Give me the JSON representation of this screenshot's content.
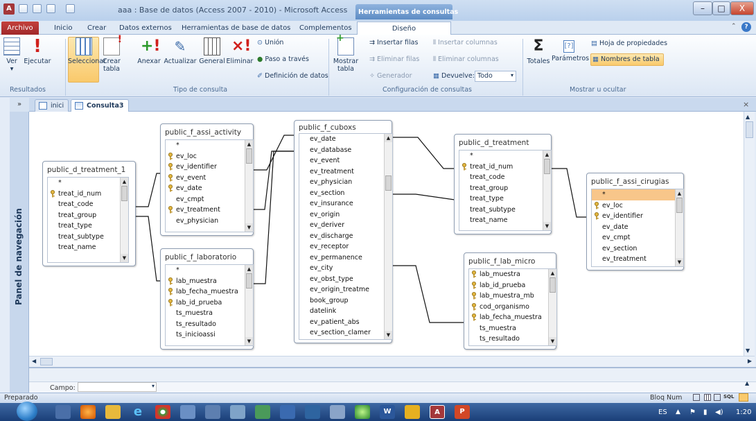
{
  "window": {
    "title": "aaa : Base de datos (Access 2007 - 2010) - Microsoft Access",
    "context_tab_title": "Herramientas de consultas",
    "minimize": "–",
    "maximize": "□",
    "close": "X"
  },
  "menu": {
    "file": "Archivo",
    "tabs": [
      "Inicio",
      "Crear",
      "Datos externos",
      "Herramientas de base de datos",
      "Complementos"
    ],
    "design_tab": "Diseño"
  },
  "ribbon": {
    "results": {
      "ver": "Ver",
      "ejecutar": "Ejecutar",
      "group": "Resultados"
    },
    "query_type": {
      "seleccionar": "Seleccionar",
      "crear_tabla": "Crear tabla",
      "anexar": "Anexar",
      "actualizar": "Actualizar",
      "general": "General",
      "eliminar": "Eliminar",
      "union": "Unión",
      "paso_traves": "Paso a través",
      "definicion": "Definición de datos",
      "group": "Tipo de consulta"
    },
    "setup": {
      "mostrar_tabla": "Mostrar tabla",
      "insertar_filas": "Insertar filas",
      "eliminar_filas": "Eliminar filas",
      "generador": "Generador",
      "insertar_columnas": "Insertar columnas",
      "eliminar_columnas": "Eliminar columnas",
      "devuelve": "Devuelve:",
      "devuelve_value": "Todo",
      "group": "Configuración de consultas"
    },
    "show": {
      "totales": "Totales",
      "parametros": "Parámetros",
      "hoja_prop": "Hoja de propiedades",
      "nombres_tabla": "Nombres de tabla",
      "group": "Mostrar u ocultar"
    }
  },
  "nav": {
    "toggle": "»",
    "label": "Panel de navegación"
  },
  "doctabs": {
    "tab1": "inici",
    "tab2": "Consulta3",
    "close": "×"
  },
  "tables": {
    "t1": {
      "title": "public_d_treatment_1",
      "fields": [
        "*",
        "treat_id_num",
        "treat_code",
        "treat_group",
        "treat_type",
        "treat_subtype",
        "treat_name"
      ],
      "keys": [
        1
      ]
    },
    "t2": {
      "title": "public_f_assi_activity",
      "fields": [
        "*",
        "ev_loc",
        "ev_identifier",
        "ev_event",
        "ev_date",
        "ev_cmpt",
        "ev_treatment",
        "ev_physician"
      ],
      "keys": [
        1,
        2,
        3,
        4,
        6
      ]
    },
    "t3": {
      "title": "public_f_laboratorio",
      "fields": [
        "*",
        "lab_muestra",
        "lab_fecha_muestra",
        "lab_id_prueba",
        "ts_muestra",
        "ts_resultado",
        "ts_inicioassi"
      ],
      "keys": [
        1,
        2,
        3
      ]
    },
    "t4": {
      "title": "public_f_cuboxs",
      "fields": [
        "ev_date",
        "ev_database",
        "ev_event",
        "ev_treatment",
        "ev_physician",
        "ev_section",
        "ev_insurance",
        "ev_origin",
        "ev_deriver",
        "ev_discharge",
        "ev_receptor",
        "ev_permanence",
        "ev_city",
        "ev_obst_type",
        "ev_origin_treatme",
        "book_group",
        "datelink",
        "ev_patient_abs",
        "ev_section_clamer"
      ],
      "keys": []
    },
    "t5": {
      "title": "public_d_treatment",
      "fields": [
        "*",
        "treat_id_num",
        "treat_code",
        "treat_group",
        "treat_type",
        "treat_subtype",
        "treat_name"
      ],
      "keys": [
        1
      ]
    },
    "t6": {
      "title": "public_f_lab_micro",
      "fields": [
        "lab_muestra",
        "lab_id_prueba",
        "lab_muestra_mb",
        "cod_organismo",
        "lab_fecha_muestra",
        "ts_muestra",
        "ts_resultado"
      ],
      "keys": [
        0,
        1,
        2,
        3,
        4
      ]
    },
    "t7": {
      "title": "public_f_assi_cirugias",
      "fields": [
        "*",
        "ev_loc",
        "ev_identifier",
        "ev_date",
        "ev_cmpt",
        "ev_section",
        "ev_treatment"
      ],
      "keys": [
        1,
        2
      ]
    }
  },
  "grid": {
    "campo": "Campo:"
  },
  "status": {
    "left": "Preparado",
    "bloq": "Bloq Num",
    "sql": "SQL"
  },
  "taskbar": {
    "lang": "ES",
    "time": "1:20"
  },
  "colors": {
    "file_tab": "#b0302f",
    "selected": "#f9c96b",
    "context": "#6b95c9"
  }
}
